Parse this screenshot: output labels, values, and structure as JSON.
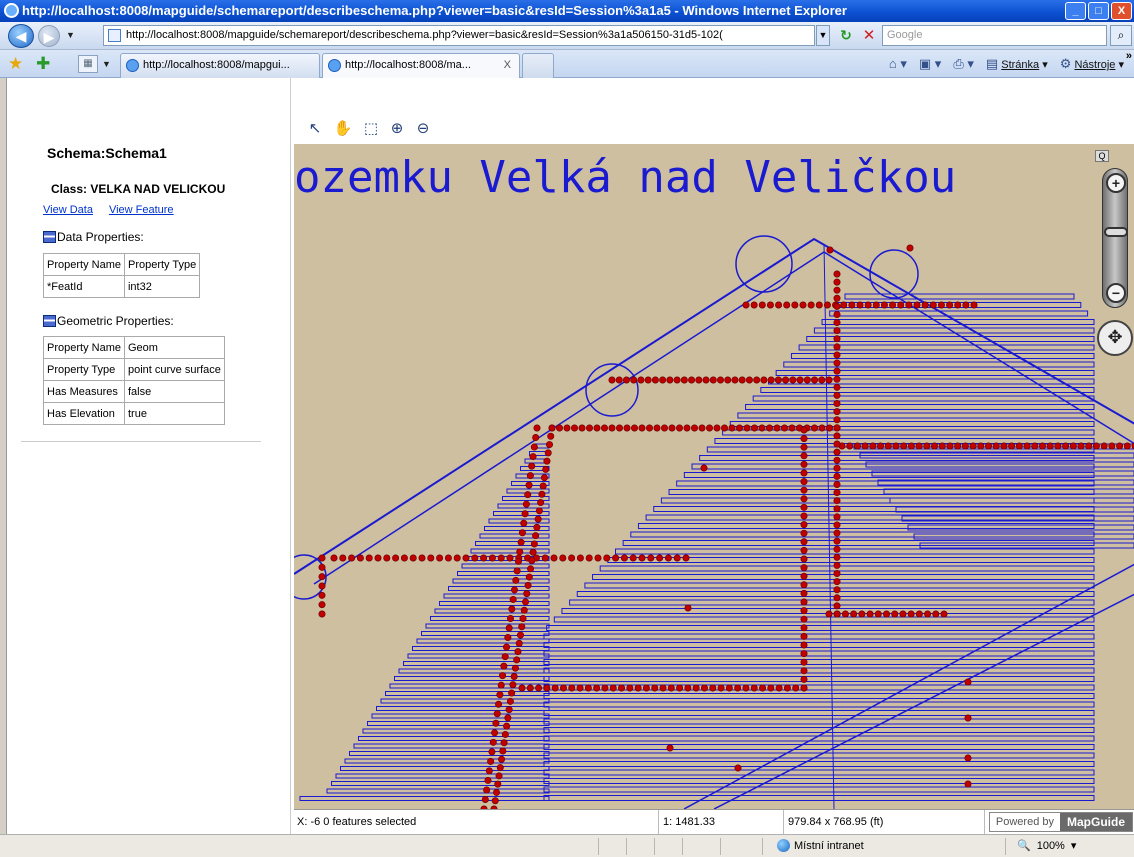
{
  "window": {
    "title": "http://localhost:8008/mapguide/schemareport/describeschema.php?viewer=basic&resId=Session%3a1a5 - Windows Internet Explorer",
    "min": "_",
    "max": "□",
    "close": "X"
  },
  "address": {
    "url": "http://localhost:8008/mapguide/schemareport/describeschema.php?viewer=basic&resId=Session%3a1a506150-31d5-102(",
    "search_placeholder": "Google"
  },
  "tabs": [
    {
      "label": "http://localhost:8008/mapgui..."
    },
    {
      "label": "http://localhost:8008/ma...",
      "close": "X"
    }
  ],
  "commandbar": {
    "page": "Stránka",
    "tools": "Nástroje",
    "more": "»"
  },
  "schema": {
    "title": "Schema:Schema1",
    "class_title": "Class: VELKA NAD VELICKOU",
    "view_data": "View Data",
    "view_feature": "View Feature",
    "data_properties_label": "Data Properties:",
    "data_properties": {
      "headers": [
        "Property Name",
        "Property Type"
      ],
      "rows": [
        [
          "*FeatId",
          "int32"
        ]
      ]
    },
    "geometric_properties_label": "Geometric Properties:",
    "geometric_properties": [
      [
        "Property Name",
        "Geom"
      ],
      [
        "Property Type",
        "point curve surface"
      ],
      [
        "Has Measures",
        "false"
      ],
      [
        "Has Elevation",
        "true"
      ]
    ]
  },
  "map": {
    "label_text": "ozemku Velká nad Veličkou",
    "zoom_q": "Q",
    "status": {
      "coords": "X: -6",
      "selected": "0 features selected",
      "scale": "1: 1481.33",
      "size": "979.84 x 768.95 (ft)",
      "powered_by": "Powered by",
      "brand": "MapGuide"
    },
    "colors": {
      "background": "#cebfa1",
      "lines": "#1a1ad0",
      "points": "#c00000"
    }
  },
  "statusbar": {
    "zone": "Místní intranet",
    "zoom": "100%"
  }
}
